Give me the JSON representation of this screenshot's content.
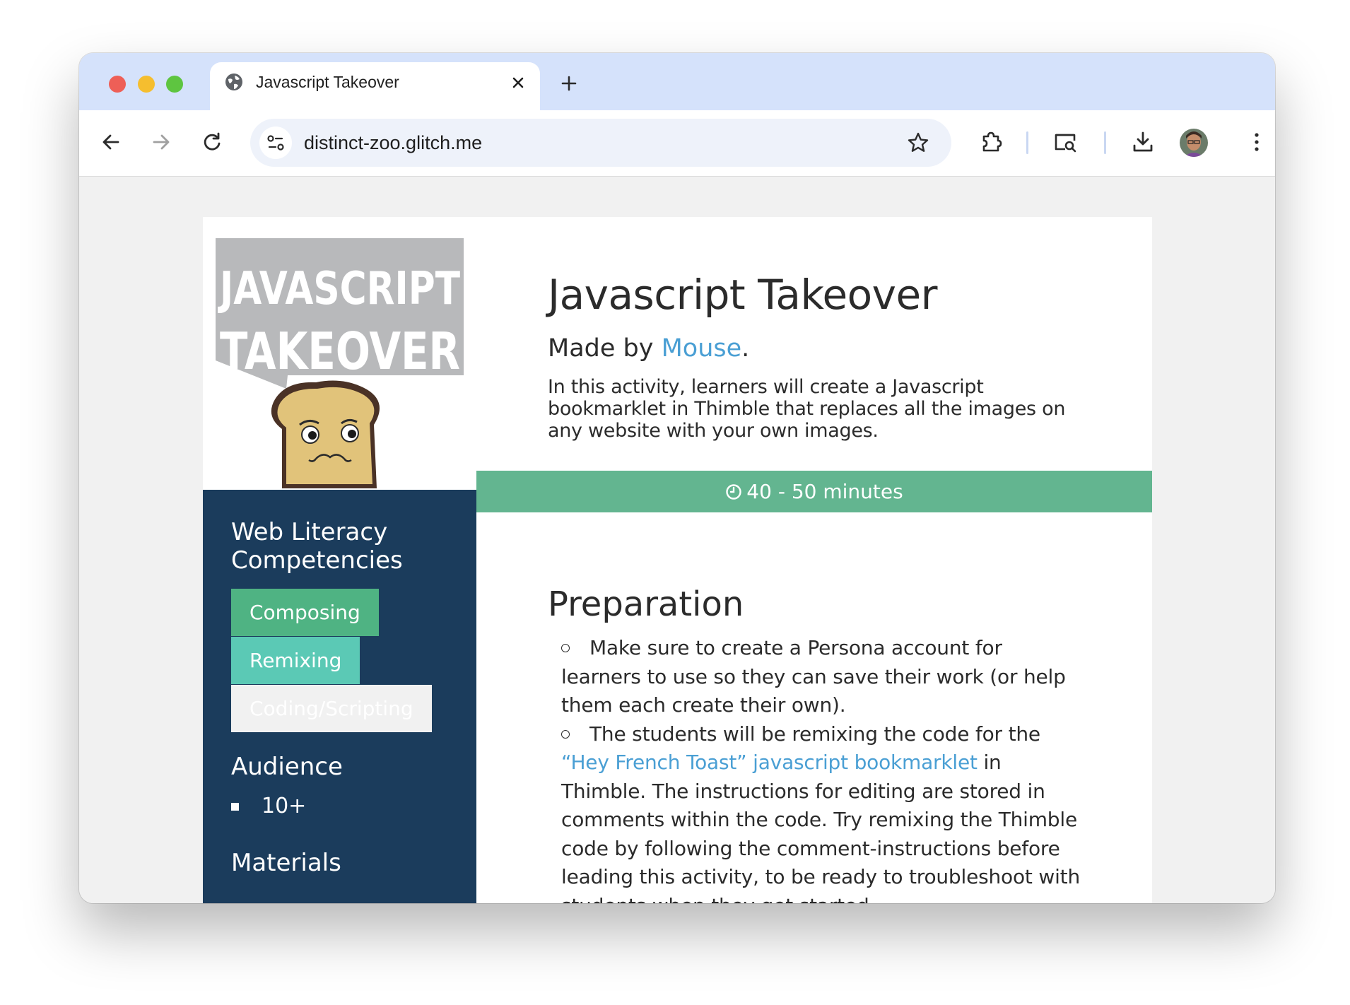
{
  "browser": {
    "tab_title": "Javascript Takeover",
    "url": "distinct-zoo.glitch.me"
  },
  "logo": {
    "line1": "JAVASCRIPT",
    "line2": "TAKEOVER"
  },
  "page": {
    "title": "Javascript Takeover",
    "made_by_prefix": "Made by ",
    "author": "Mouse",
    "made_by_suffix": ".",
    "intro": "In this activity, learners will create a Javascript bookmarklet in Thimble that replaces all the images on any website with your own images.",
    "duration": "40 - 50 minutes"
  },
  "sidebar": {
    "competencies_heading": "Web Literacy Competencies",
    "competencies": [
      "Composing",
      "Remixing",
      "Coding/Scripting"
    ],
    "audience_heading": "Audience",
    "audience": [
      "10+"
    ],
    "materials_heading": "Materials"
  },
  "preparation": {
    "heading": "Preparation",
    "item1": "Make sure to create a Persona account for learners to use so they can save their work (or help them each create their own).",
    "item2_before": "The students will be remixing the code for the ",
    "item2_link": "“Hey French Toast” javascript bookmarklet",
    "item2_after": " in Thimble. The instructions for editing are stored in comments within the code. Try remixing the Thimble code by following the comment-instructions before leading this activity, to be ready to troubleshoot with students when they get started."
  },
  "colors": {
    "sidebar_bg": "#1b3c5c",
    "time_bar": "#63b590",
    "link": "#4a9fd4",
    "tag_composing": "#4fb383",
    "tag_remixing": "#5bc9b5"
  }
}
